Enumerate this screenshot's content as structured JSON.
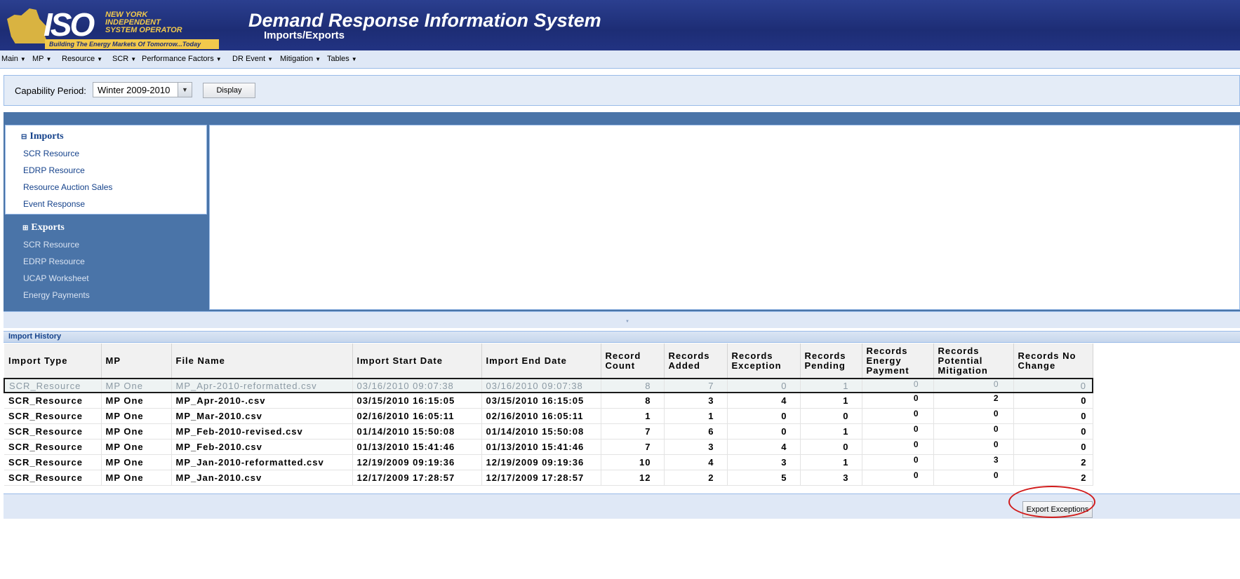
{
  "header": {
    "logo_iso": "ISO",
    "logo_org_lines": [
      "NEW YORK",
      "INDEPENDENT",
      "SYSTEM OPERATOR"
    ],
    "logo_tagline": "Building The Energy Markets Of Tomorrow...Today",
    "title": "Demand Response Information System",
    "subtitle": "Imports/Exports",
    "colors": {
      "banner": "#1d2d75",
      "logo_gold": "#f2c94c"
    }
  },
  "menu": [
    {
      "label": "Main",
      "icon": "caret-down-icon"
    },
    {
      "label": "MP",
      "icon": "caret-down-icon"
    },
    {
      "label": "Resource",
      "icon": "caret-down-icon"
    },
    {
      "label": "SCR",
      "icon": "caret-down-icon"
    },
    {
      "label": "Performance Factors",
      "icon": "caret-down-icon"
    },
    {
      "label": "DR Event",
      "icon": "caret-down-icon"
    },
    {
      "label": "Mitigation",
      "icon": "caret-down-icon"
    },
    {
      "label": "Tables",
      "icon": "caret-down-icon"
    }
  ],
  "capability": {
    "label": "Capability Period:",
    "selected": "Winter 2009-2010",
    "display_button": "Display"
  },
  "nav": {
    "imports": {
      "title": "Imports",
      "toggle_icon": "collapse-icon",
      "items": [
        "SCR Resource",
        "EDRP Resource",
        "Resource Auction Sales",
        "Event Response"
      ]
    },
    "exports": {
      "title": "Exports",
      "toggle_icon": "expand-icon",
      "items": [
        "SCR Resource",
        "EDRP Resource",
        "UCAP Worksheet",
        "Energy Payments"
      ]
    }
  },
  "history": {
    "title": "Import History",
    "columns": [
      "Import Type",
      "MP",
      "File Name",
      "Import Start Date",
      "Import End Date",
      "Record Count",
      "Records Added",
      "Records Exception",
      "Records Pending",
      "Records Energy Payment",
      "Records Potential Mitigation",
      "Records No Change"
    ],
    "rows": [
      {
        "type": "SCR_Resource",
        "mp": "MP One",
        "file": "MP_Apr-2010-reformatted.csv",
        "start": "03/16/2010 09:07:38",
        "end": "03/16/2010 09:07:38",
        "count": "8",
        "added": "7",
        "exception": "0",
        "pending": "1",
        "energy": "0",
        "mitigation": "0",
        "nochange": "0"
      },
      {
        "type": "SCR_Resource",
        "mp": "MP One",
        "file": "MP_Apr-2010-.csv",
        "start": "03/15/2010 16:15:05",
        "end": "03/15/2010 16:15:05",
        "count": "8",
        "added": "3",
        "exception": "4",
        "pending": "1",
        "energy": "0",
        "mitigation": "2",
        "nochange": "0"
      },
      {
        "type": "SCR_Resource",
        "mp": "MP One",
        "file": "MP_Mar-2010.csv",
        "start": "02/16/2010 16:05:11",
        "end": "02/16/2010 16:05:11",
        "count": "1",
        "added": "1",
        "exception": "0",
        "pending": "0",
        "energy": "0",
        "mitigation": "0",
        "nochange": "0"
      },
      {
        "type": "SCR_Resource",
        "mp": "MP One",
        "file": "MP_Feb-2010-revised.csv",
        "start": "01/14/2010 15:50:08",
        "end": "01/14/2010 15:50:08",
        "count": "7",
        "added": "6",
        "exception": "0",
        "pending": "1",
        "energy": "0",
        "mitigation": "0",
        "nochange": "0"
      },
      {
        "type": "SCR_Resource",
        "mp": "MP One",
        "file": "MP_Feb-2010.csv",
        "start": "01/13/2010 15:41:46",
        "end": "01/13/2010 15:41:46",
        "count": "7",
        "added": "3",
        "exception": "4",
        "pending": "0",
        "energy": "0",
        "mitigation": "0",
        "nochange": "0"
      },
      {
        "type": "SCR_Resource",
        "mp": "MP One",
        "file": "MP_Jan-2010-reformatted.csv",
        "start": "12/19/2009 09:19:36",
        "end": "12/19/2009 09:19:36",
        "count": "10",
        "added": "4",
        "exception": "3",
        "pending": "1",
        "energy": "0",
        "mitigation": "3",
        "nochange": "2"
      },
      {
        "type": "SCR_Resource",
        "mp": "MP One",
        "file": "MP_Jan-2010.csv",
        "start": "12/17/2009 17:28:57",
        "end": "12/17/2009 17:28:57",
        "count": "12",
        "added": "2",
        "exception": "5",
        "pending": "3",
        "energy": "0",
        "mitigation": "0",
        "nochange": "2"
      }
    ]
  },
  "footer": {
    "export_button": "Export Exceptions",
    "highlight_color": "#d11a1a"
  }
}
